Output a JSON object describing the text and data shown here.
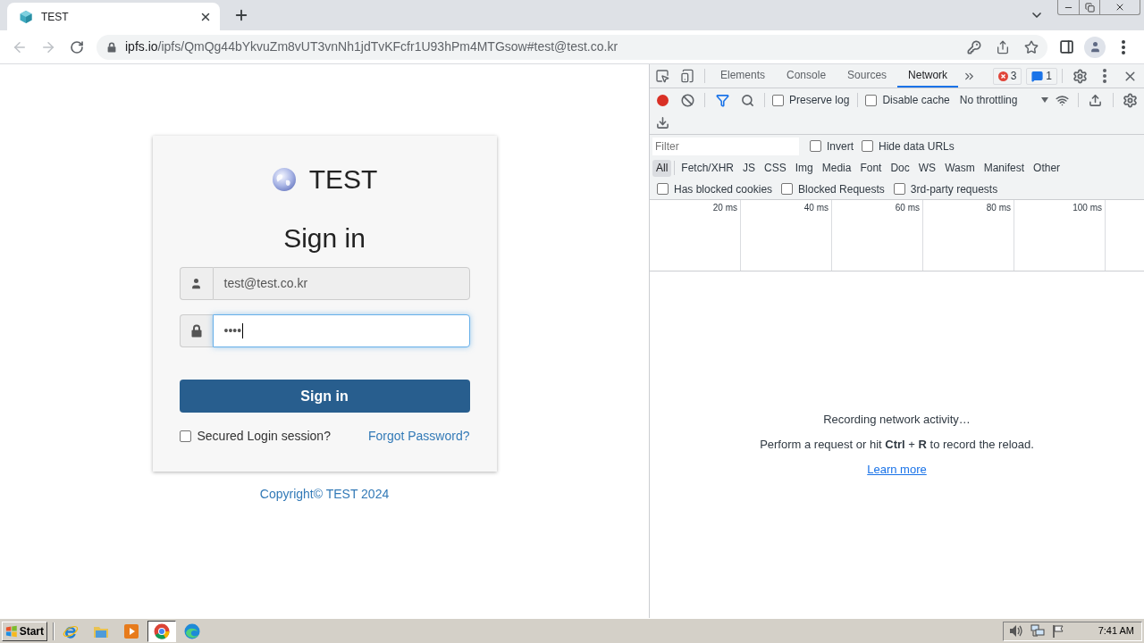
{
  "browser": {
    "tabs": [
      {
        "title": "TEST",
        "selected": true
      }
    ],
    "navigation": [
      {
        "kind": "back",
        "disabled": true
      },
      {
        "kind": "forward",
        "disabled": true
      },
      {
        "kind": "reload",
        "disabled": false
      }
    ],
    "url": {
      "host": "ipfs.io",
      "path": "/ipfs/QmQg44bYkvuZm8vUT3vnNh1jdTvKFcfr1U93hPm4MTGsow#test@test.co.kr"
    }
  },
  "login": {
    "brand": "TEST",
    "heading": "Sign in",
    "fields": [
      {
        "kind": "user",
        "value": "test@test.co.kr",
        "disabled": true,
        "focused": false
      },
      {
        "kind": "lock",
        "value": "••••",
        "disabled": false,
        "focused": true
      }
    ],
    "submit": "Sign in",
    "remember": {
      "label": "Secured Login session?",
      "checked": false
    },
    "forgot": "Forgot Password?",
    "footer": "Copyright© TEST 2024"
  },
  "devtools": {
    "tabs": [
      {
        "label": "Elements",
        "selected": false
      },
      {
        "label": "Console",
        "selected": false
      },
      {
        "label": "Sources",
        "selected": false
      },
      {
        "label": "Network",
        "selected": true
      }
    ],
    "errors": "3",
    "messages": "1",
    "toolbar_checks": [
      {
        "label": "Preserve log",
        "checked": false
      },
      {
        "label": "Disable cache",
        "checked": false
      }
    ],
    "throttling": "No throttling",
    "filter": {
      "placeholder": "Filter"
    },
    "filter_checks": [
      {
        "label": "Invert",
        "checked": false
      },
      {
        "label": "Hide data URLs",
        "checked": false
      }
    ],
    "types": [
      {
        "label": "All",
        "selected": true
      },
      {
        "label": "Fetch/XHR",
        "selected": false
      },
      {
        "label": "JS",
        "selected": false
      },
      {
        "label": "CSS",
        "selected": false
      },
      {
        "label": "Img",
        "selected": false
      },
      {
        "label": "Media",
        "selected": false
      },
      {
        "label": "Font",
        "selected": false
      },
      {
        "label": "Doc",
        "selected": false
      },
      {
        "label": "WS",
        "selected": false
      },
      {
        "label": "Wasm",
        "selected": false
      },
      {
        "label": "Manifest",
        "selected": false
      },
      {
        "label": "Other",
        "selected": false
      }
    ],
    "request_checks": [
      {
        "label": "Has blocked cookies",
        "checked": false
      },
      {
        "label": "Blocked Requests",
        "checked": false
      },
      {
        "label": "3rd-party requests",
        "checked": false
      }
    ],
    "timeline_ticks": [
      "20 ms",
      "40 ms",
      "60 ms",
      "80 ms",
      "100 ms"
    ],
    "empty_state": {
      "title": "Recording network activity…",
      "hint": "Perform a request or hit **Ctrl** + **R** to record the reload.",
      "link": "Learn more"
    }
  },
  "taskbar": {
    "start": "Start",
    "apps": [
      {
        "kind": "e-browser",
        "active": false
      },
      {
        "kind": "folder",
        "active": false
      },
      {
        "kind": "media-player",
        "active": false
      },
      {
        "kind": "round-browser",
        "active": true
      },
      {
        "kind": "wave-browser",
        "active": false
      }
    ],
    "clock": "7:41 AM"
  }
}
